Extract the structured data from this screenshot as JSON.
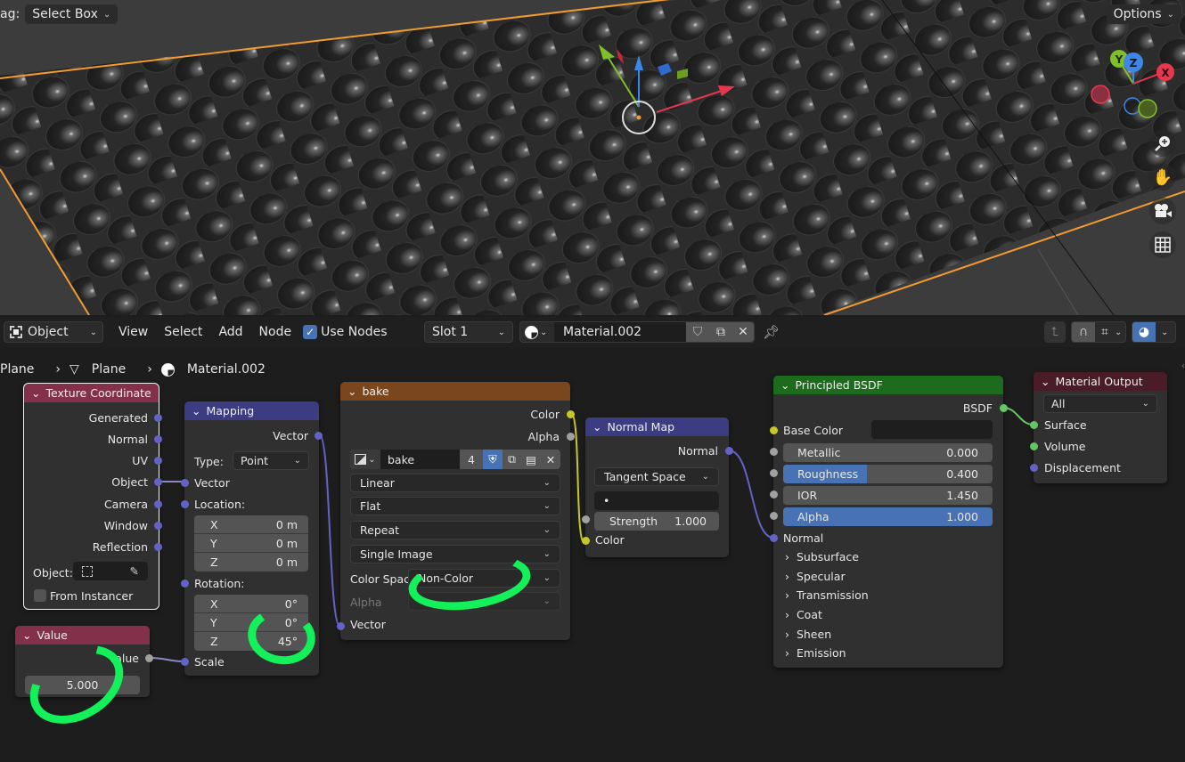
{
  "viewport": {
    "drag_label": "ag:",
    "drag_mode": "Select Box",
    "options_label": "Options",
    "gizmo": {
      "x": "X",
      "y": "Y",
      "z": "Z"
    },
    "nav_icons": [
      "zoom-icon",
      "pan-hand-icon",
      "camera-icon",
      "grid-icon"
    ]
  },
  "editor_header": {
    "mode": "Object",
    "menus": [
      "View",
      "Select",
      "Add",
      "Node"
    ],
    "use_nodes_label": "Use Nodes",
    "use_nodes_checked": true,
    "slot": "Slot 1",
    "material_name": "Material.002"
  },
  "breadcrumb": [
    "Plane",
    "Plane",
    "Material.002"
  ],
  "nodes": {
    "texture_coordinate": {
      "title": "Texture Coordinate",
      "outputs": [
        "Generated",
        "Normal",
        "UV",
        "Object",
        "Camera",
        "Window",
        "Reflection"
      ],
      "object_label": "Object:",
      "from_instancer": "From Instancer",
      "header_color": "#83314a"
    },
    "value": {
      "title": "Value",
      "output": "Value",
      "value": "5.000",
      "header_color": "#83314a"
    },
    "mapping": {
      "title": "Mapping",
      "output": "Vector",
      "type_label": "Type:",
      "type_value": "Point",
      "vector_label": "Vector",
      "location_label": "Location:",
      "location": [
        {
          "axis": "X",
          "value": "0 m"
        },
        {
          "axis": "Y",
          "value": "0 m"
        },
        {
          "axis": "Z",
          "value": "0 m"
        }
      ],
      "rotation_label": "Rotation:",
      "rotation": [
        {
          "axis": "X",
          "value": "0°"
        },
        {
          "axis": "Y",
          "value": "0°"
        },
        {
          "axis": "Z",
          "value": "45°"
        }
      ],
      "scale_label": "Scale",
      "header_color": "#3c3c83"
    },
    "image_texture": {
      "title": "bake",
      "outputs": [
        "Color",
        "Alpha"
      ],
      "image_name": "bake",
      "users": "4",
      "interpolation": "Linear",
      "projection": "Flat",
      "extension": "Repeat",
      "source": "Single Image",
      "color_space_label": "Color Space",
      "color_space": "Non-Color",
      "alpha_label": "Alpha",
      "vector_label": "Vector",
      "header_color": "#79461d"
    },
    "normal_map": {
      "title": "Normal Map",
      "output": "Normal",
      "space": "Tangent Space",
      "uv_map": "•",
      "strength_label": "Strength",
      "strength": "1.000",
      "color_label": "Color",
      "header_color": "#3c3c83"
    },
    "principled": {
      "title": "Principled BSDF",
      "output": "BSDF",
      "base_color_label": "Base Color",
      "metallic": {
        "label": "Metallic",
        "value": "0.000",
        "fill": 0.0
      },
      "roughness": {
        "label": "Roughness",
        "value": "0.400",
        "fill": 0.4
      },
      "ior": {
        "label": "IOR",
        "value": "1.450",
        "fill": 0.0
      },
      "alpha": {
        "label": "Alpha",
        "value": "1.000",
        "fill": 1.0
      },
      "normal_label": "Normal",
      "panels": [
        "Subsurface",
        "Specular",
        "Transmission",
        "Coat",
        "Sheen",
        "Emission"
      ],
      "header_color": "#1d6b1d"
    },
    "material_output": {
      "title": "Material Output",
      "target": "All",
      "inputs": [
        "Surface",
        "Volume",
        "Displacement"
      ],
      "header_color": "#4a1c28"
    }
  },
  "colors": {
    "accent_blue": "#4772b3",
    "annotation_green": "#13f05a",
    "selection_orange": "#f29b30"
  }
}
